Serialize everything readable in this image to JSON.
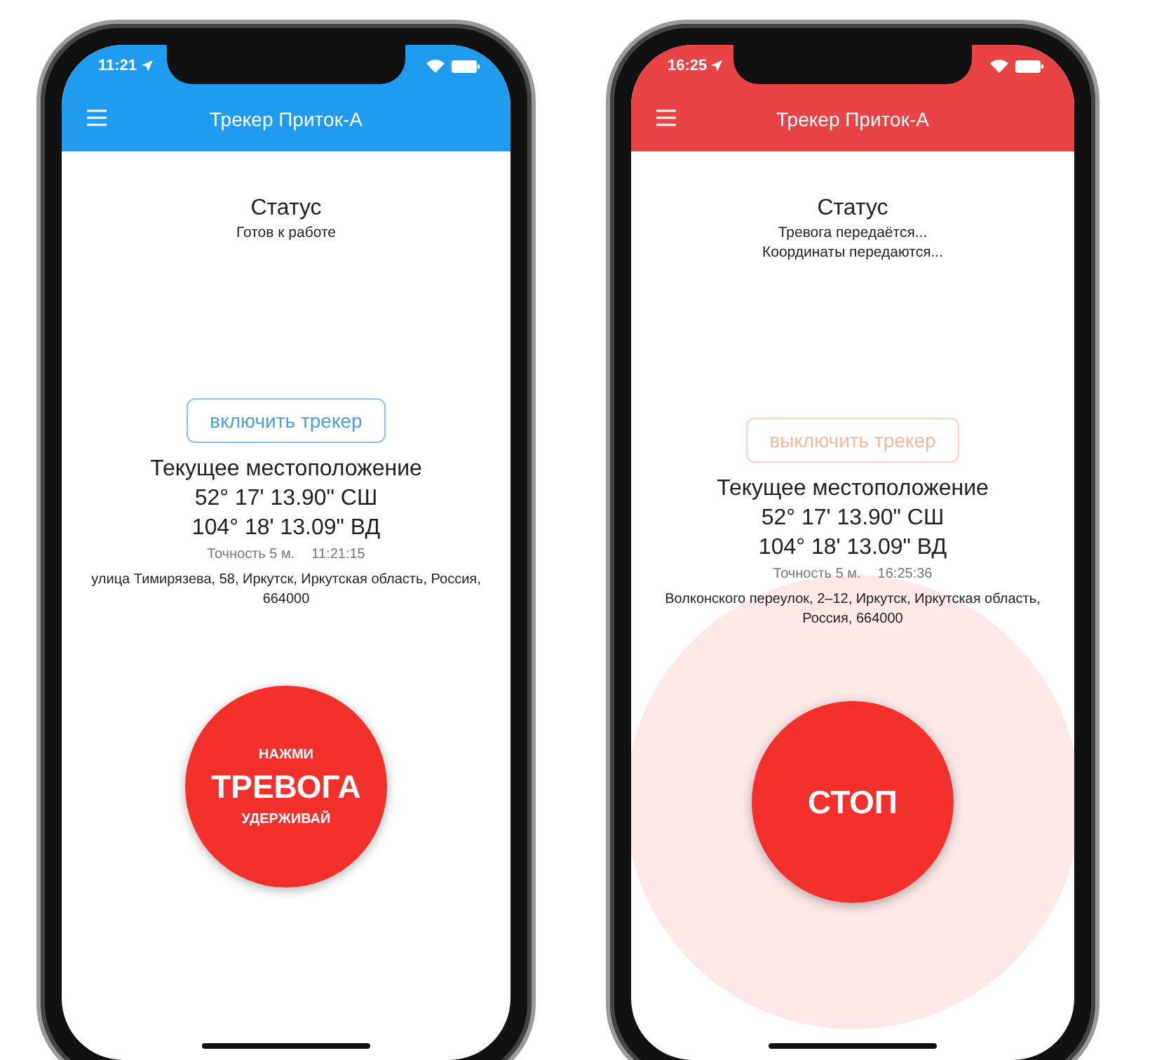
{
  "phones": [
    {
      "color": "#1f9cf0",
      "time": "11:21",
      "title": "Трекер Приток-А",
      "status_title": "Статус",
      "status_lines": [
        "Готов к работе"
      ],
      "tracker_button": {
        "label": "включить трекер",
        "kind": "on"
      },
      "location_title": "Текущее местоположение",
      "latitude": "52° 17' 13.90\" СШ",
      "longitude": "104° 18' 13.09\" ВД",
      "accuracy": "Точность 5 м.",
      "fix_time": "11:21:15",
      "address": "улица Тимирязева, 58, Иркутск, Иркутская область, Россия, 664000",
      "alarm_active": false,
      "alarm_button": {
        "kind": "start",
        "lines": [
          "НАЖМИ",
          "ТРЕВОГА",
          "УДЕРЖИВАЙ"
        ]
      }
    },
    {
      "color": "#e84345",
      "time": "16:25",
      "title": "Трекер Приток-А",
      "status_title": "Статус",
      "status_lines": [
        "Тревога передаётся...",
        "Координаты передаются..."
      ],
      "tracker_button": {
        "label": "выключить трекер",
        "kind": "off"
      },
      "location_title": "Текущее местоположение",
      "latitude": "52° 17' 13.90\" СШ",
      "longitude": "104° 18' 13.09\" ВД",
      "accuracy": "Точность 5 м.",
      "fix_time": "16:25:36",
      "address": "Волконского переулок, 2–12, Иркутск, Иркутская область, Россия, 664000",
      "alarm_active": true,
      "alarm_button": {
        "kind": "stop",
        "lines": [
          "СТОП"
        ]
      }
    }
  ]
}
